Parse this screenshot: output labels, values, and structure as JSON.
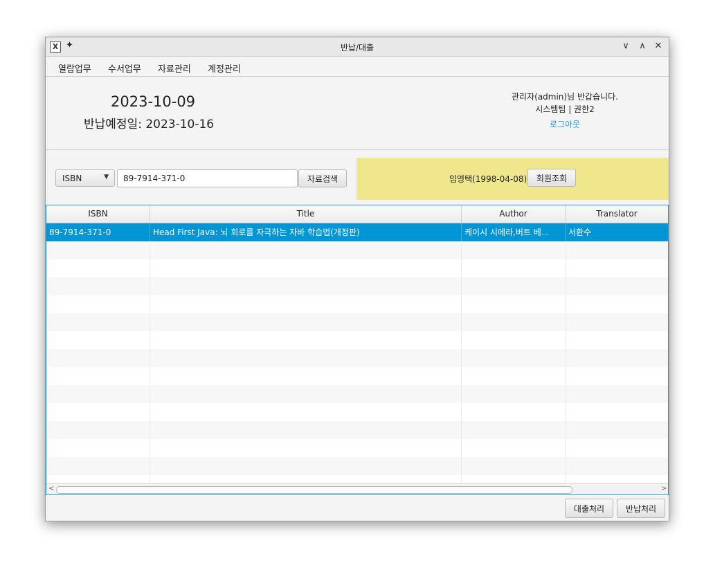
{
  "window": {
    "title": "반납/대출",
    "app_icon": "x-app-icon",
    "controls": {
      "minimize": "∨",
      "maximize": "∧",
      "close": "✕"
    }
  },
  "menu": [
    "열람업무",
    "수서업무",
    "자료관리",
    "계정관리"
  ],
  "header": {
    "date": "2023-10-09",
    "due_date": "반납예정일: 2023-10-16",
    "greeting": "관리자(admin)님 반갑습니다.",
    "team": "시스템팀 | 권한2",
    "logout": "로그아웃"
  },
  "search": {
    "type": "ISBN",
    "value": "89-7914-371-0",
    "button": "자료검색"
  },
  "member": {
    "name": "임영택(1998-04-08)",
    "lookup_button": "회원조회",
    "panel_color": "#f0e68c"
  },
  "table": {
    "columns": [
      "ISBN",
      "Title",
      "Author",
      "Translator"
    ],
    "rows": [
      [
        "89-7914-371-0",
        "Head First Java: 뇌 회로를 자극하는 자바 학습법(개정판)",
        "케이시 시에라,버트 베...",
        "서환수"
      ]
    ],
    "selection_color": "#0096d6"
  },
  "actions": {
    "loan": "대출처리",
    "return": "반납처리"
  }
}
